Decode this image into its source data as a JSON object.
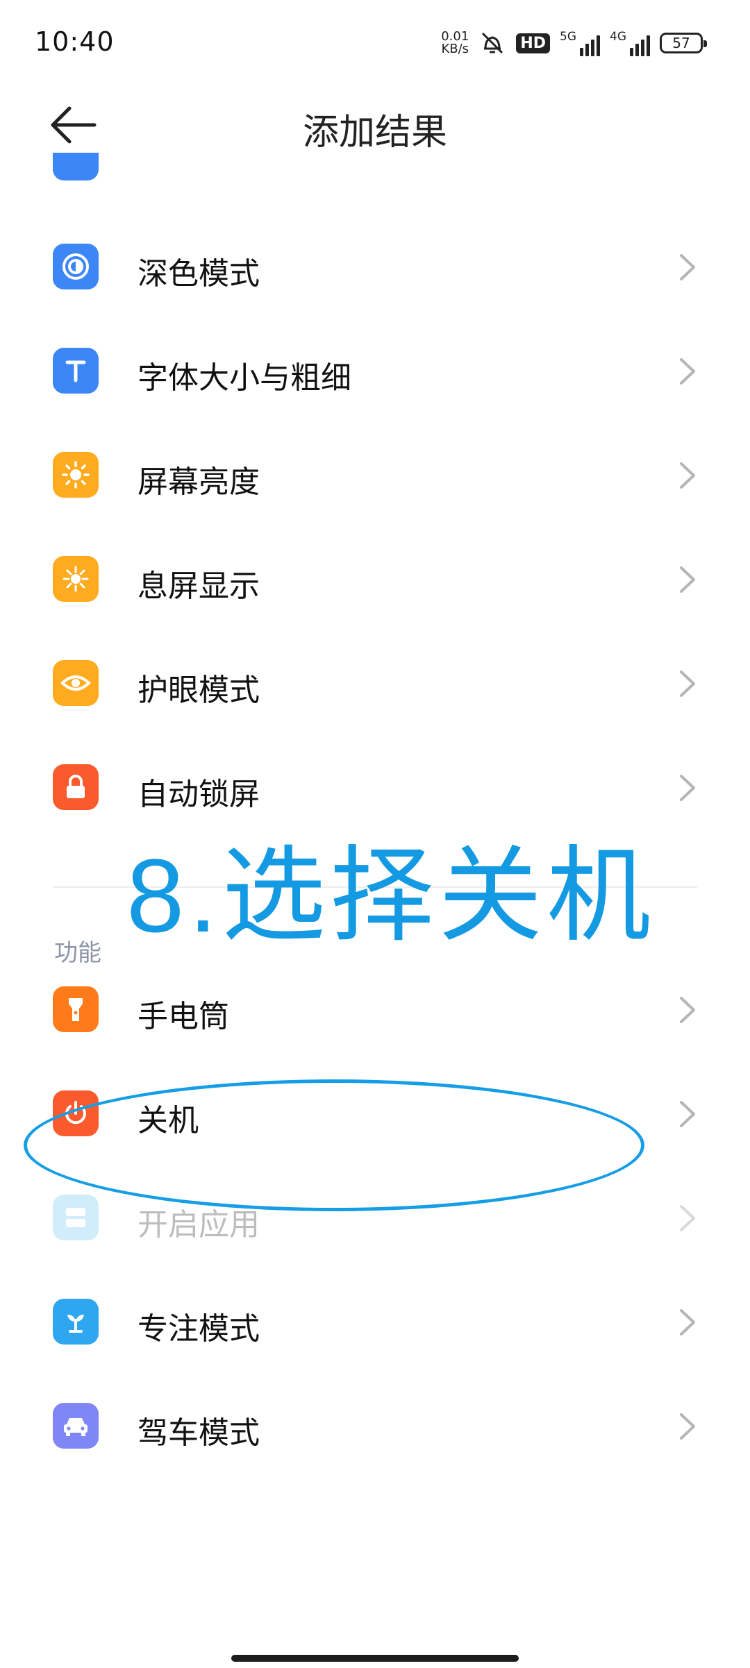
{
  "status_bar": {
    "time": "10:40",
    "speed_value": "0.01",
    "speed_unit": "KB/s",
    "hd_label": "HD",
    "net1": "5G",
    "net2": "4G",
    "battery": "57"
  },
  "header": {
    "title": "添加结果"
  },
  "list_top": [
    {
      "label": "深色模式",
      "icon": "dark-mode-icon",
      "color": "#3d86f5"
    },
    {
      "label": "字体大小与粗细",
      "icon": "font-size-icon",
      "color": "#3d86f5"
    },
    {
      "label": "屏幕亮度",
      "icon": "brightness-icon",
      "color": "#ffab1f"
    },
    {
      "label": "息屏显示",
      "icon": "always-on-display-icon",
      "color": "#ffab1f"
    },
    {
      "label": "护眼模式",
      "icon": "eye-icon",
      "color": "#ffab1f"
    },
    {
      "label": "自动锁屏",
      "icon": "lock-icon",
      "color": "#fb5a2d"
    }
  ],
  "section_functions": "功能",
  "list_functions": [
    {
      "label": "手电筒",
      "icon": "flashlight-icon",
      "color": "#ff7b1a"
    },
    {
      "label": "关机",
      "icon": "power-icon",
      "color": "#fb5a2d"
    },
    {
      "label": "开启应用",
      "icon": "open-app-icon",
      "color": "#9bd7f5",
      "disabled": true
    },
    {
      "label": "专注模式",
      "icon": "focus-mode-icon",
      "color": "#2ea7f0"
    },
    {
      "label": "驾车模式",
      "icon": "car-icon",
      "color": "#7f86f5"
    }
  ],
  "annotation": {
    "text": "8.选择关机",
    "color": "#149ae2"
  }
}
